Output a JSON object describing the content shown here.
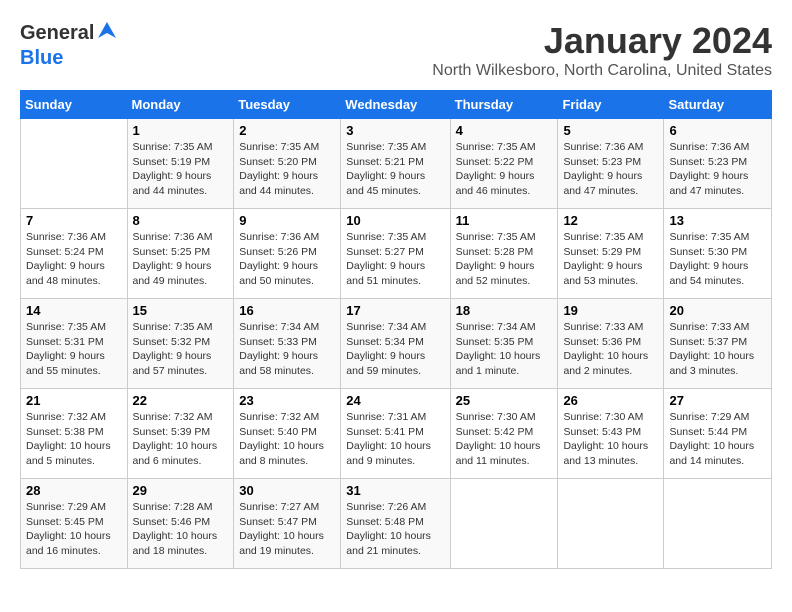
{
  "header": {
    "logo_general": "General",
    "logo_blue": "Blue",
    "title": "January 2024",
    "subtitle": "North Wilkesboro, North Carolina, United States"
  },
  "days_of_week": [
    "Sunday",
    "Monday",
    "Tuesday",
    "Wednesday",
    "Thursday",
    "Friday",
    "Saturday"
  ],
  "weeks": [
    [
      {
        "day": "",
        "info": ""
      },
      {
        "day": "1",
        "info": "Sunrise: 7:35 AM\nSunset: 5:19 PM\nDaylight: 9 hours\nand 44 minutes."
      },
      {
        "day": "2",
        "info": "Sunrise: 7:35 AM\nSunset: 5:20 PM\nDaylight: 9 hours\nand 44 minutes."
      },
      {
        "day": "3",
        "info": "Sunrise: 7:35 AM\nSunset: 5:21 PM\nDaylight: 9 hours\nand 45 minutes."
      },
      {
        "day": "4",
        "info": "Sunrise: 7:35 AM\nSunset: 5:22 PM\nDaylight: 9 hours\nand 46 minutes."
      },
      {
        "day": "5",
        "info": "Sunrise: 7:36 AM\nSunset: 5:23 PM\nDaylight: 9 hours\nand 47 minutes."
      },
      {
        "day": "6",
        "info": "Sunrise: 7:36 AM\nSunset: 5:23 PM\nDaylight: 9 hours\nand 47 minutes."
      }
    ],
    [
      {
        "day": "7",
        "info": "Sunrise: 7:36 AM\nSunset: 5:24 PM\nDaylight: 9 hours\nand 48 minutes."
      },
      {
        "day": "8",
        "info": "Sunrise: 7:36 AM\nSunset: 5:25 PM\nDaylight: 9 hours\nand 49 minutes."
      },
      {
        "day": "9",
        "info": "Sunrise: 7:36 AM\nSunset: 5:26 PM\nDaylight: 9 hours\nand 50 minutes."
      },
      {
        "day": "10",
        "info": "Sunrise: 7:35 AM\nSunset: 5:27 PM\nDaylight: 9 hours\nand 51 minutes."
      },
      {
        "day": "11",
        "info": "Sunrise: 7:35 AM\nSunset: 5:28 PM\nDaylight: 9 hours\nand 52 minutes."
      },
      {
        "day": "12",
        "info": "Sunrise: 7:35 AM\nSunset: 5:29 PM\nDaylight: 9 hours\nand 53 minutes."
      },
      {
        "day": "13",
        "info": "Sunrise: 7:35 AM\nSunset: 5:30 PM\nDaylight: 9 hours\nand 54 minutes."
      }
    ],
    [
      {
        "day": "14",
        "info": "Sunrise: 7:35 AM\nSunset: 5:31 PM\nDaylight: 9 hours\nand 55 minutes."
      },
      {
        "day": "15",
        "info": "Sunrise: 7:35 AM\nSunset: 5:32 PM\nDaylight: 9 hours\nand 57 minutes."
      },
      {
        "day": "16",
        "info": "Sunrise: 7:34 AM\nSunset: 5:33 PM\nDaylight: 9 hours\nand 58 minutes."
      },
      {
        "day": "17",
        "info": "Sunrise: 7:34 AM\nSunset: 5:34 PM\nDaylight: 9 hours\nand 59 minutes."
      },
      {
        "day": "18",
        "info": "Sunrise: 7:34 AM\nSunset: 5:35 PM\nDaylight: 10 hours\nand 1 minute."
      },
      {
        "day": "19",
        "info": "Sunrise: 7:33 AM\nSunset: 5:36 PM\nDaylight: 10 hours\nand 2 minutes."
      },
      {
        "day": "20",
        "info": "Sunrise: 7:33 AM\nSunset: 5:37 PM\nDaylight: 10 hours\nand 3 minutes."
      }
    ],
    [
      {
        "day": "21",
        "info": "Sunrise: 7:32 AM\nSunset: 5:38 PM\nDaylight: 10 hours\nand 5 minutes."
      },
      {
        "day": "22",
        "info": "Sunrise: 7:32 AM\nSunset: 5:39 PM\nDaylight: 10 hours\nand 6 minutes."
      },
      {
        "day": "23",
        "info": "Sunrise: 7:32 AM\nSunset: 5:40 PM\nDaylight: 10 hours\nand 8 minutes."
      },
      {
        "day": "24",
        "info": "Sunrise: 7:31 AM\nSunset: 5:41 PM\nDaylight: 10 hours\nand 9 minutes."
      },
      {
        "day": "25",
        "info": "Sunrise: 7:30 AM\nSunset: 5:42 PM\nDaylight: 10 hours\nand 11 minutes."
      },
      {
        "day": "26",
        "info": "Sunrise: 7:30 AM\nSunset: 5:43 PM\nDaylight: 10 hours\nand 13 minutes."
      },
      {
        "day": "27",
        "info": "Sunrise: 7:29 AM\nSunset: 5:44 PM\nDaylight: 10 hours\nand 14 minutes."
      }
    ],
    [
      {
        "day": "28",
        "info": "Sunrise: 7:29 AM\nSunset: 5:45 PM\nDaylight: 10 hours\nand 16 minutes."
      },
      {
        "day": "29",
        "info": "Sunrise: 7:28 AM\nSunset: 5:46 PM\nDaylight: 10 hours\nand 18 minutes."
      },
      {
        "day": "30",
        "info": "Sunrise: 7:27 AM\nSunset: 5:47 PM\nDaylight: 10 hours\nand 19 minutes."
      },
      {
        "day": "31",
        "info": "Sunrise: 7:26 AM\nSunset: 5:48 PM\nDaylight: 10 hours\nand 21 minutes."
      },
      {
        "day": "",
        "info": ""
      },
      {
        "day": "",
        "info": ""
      },
      {
        "day": "",
        "info": ""
      }
    ]
  ]
}
